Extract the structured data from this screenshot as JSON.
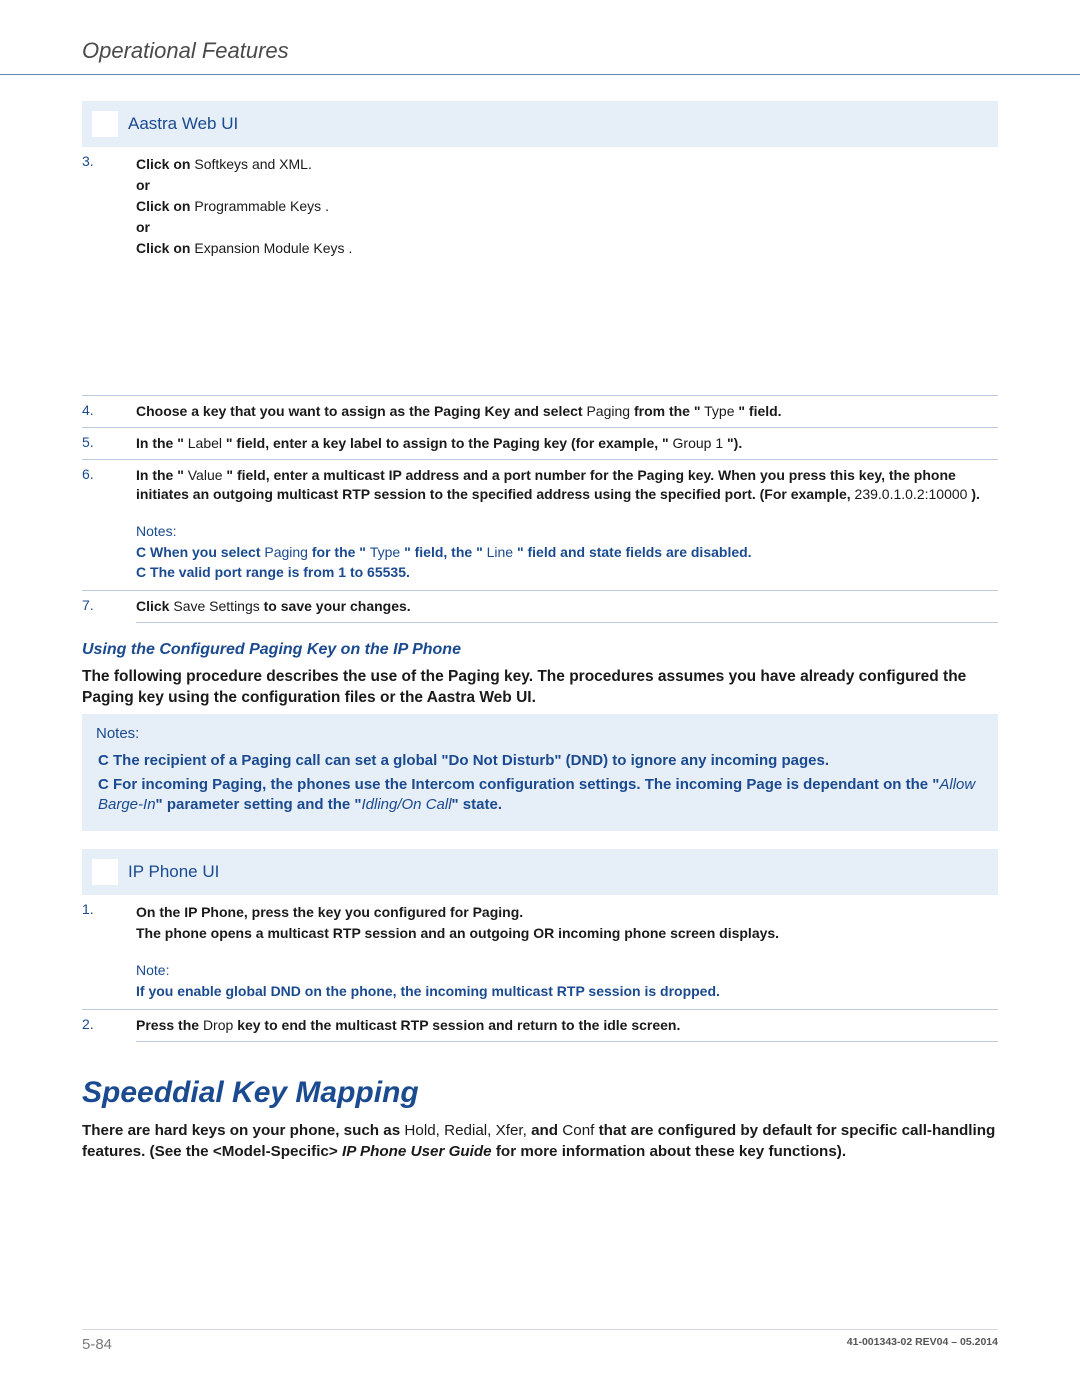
{
  "header_title": "Operational Features",
  "webui_bar_title": "Aastra Web UI",
  "step3_num": "3.",
  "step3_l1_a": "Click on",
  "step3_l1_b": " Softkeys and XML.",
  "step3_or": "or",
  "step3_l2_a": "Click on",
  "step3_l2_b": " Programmable Keys .",
  "step3_l3_a": "Click on",
  "step3_l3_b": " Expansion Module Keys .",
  "step4_num": "4.",
  "step4_a": "Choose a key that you want to assign as the Paging Key and select ",
  "step4_b": "Paging",
  "step4_c": " from the \"",
  "step4_d": "Type",
  "step4_e": "\" field.",
  "step5_num": "5.",
  "step5_a": "In the \"",
  "step5_b": "Label",
  "step5_c": "\" field, enter a key label to assign to the Paging key (for example, \"",
  "step5_d": "Group 1",
  "step5_e": "\").",
  "step6_num": "6.",
  "step6_a": "In the \"",
  "step6_b": "Value",
  "step6_c": "\" field, enter a multicast IP address and a port number for the Paging key. When you press this key, the phone initiates an outgoing multicast RTP session to the specified address using the specified port. (For example, ",
  "step6_d": "239.0.1.0.2:10000",
  "step6_e": ").",
  "step6_notes_label": "Notes:",
  "step6_note1_a": "C",
  "step6_note1_b": "When you select ",
  "step6_note1_c": "Paging",
  "step6_note1_d": " for the \"",
  "step6_note1_e": "Type",
  "step6_note1_f": "\" field, the \"",
  "step6_note1_g": "Line",
  "step6_note1_h": "\" field and state fields are disabled.",
  "step6_note2_a": "C",
  "step6_note2_b": "The valid port range is from 1 to 65535.",
  "step7_num": "7.",
  "step7_a": "Click ",
  "step7_b": "Save Settings",
  "step7_c": " to save your changes.",
  "sub_title": "Using the Configured Paging Key on the IP Phone",
  "intro_para": "The following procedure describes the use of the Paging key. The procedures assumes you have already configured the Paging key using the configuration files or the Aastra Web UI.",
  "notes_label2": "Notes:",
  "notes_b1_a": "C",
  "notes_b1_b": " The recipient of a Paging call can set a global \"Do Not Disturb\" (DND) to ignore any incoming pages.",
  "notes_b2_a": "C",
  "notes_b2_b": " For incoming Paging, the phones use the Intercom configuration settings. The incoming Page is dependant on the \"",
  "notes_b2_c": "Allow Barge-In",
  "notes_b2_d": "\" parameter setting and the \"",
  "notes_b2_e": "Idling/On Call",
  "notes_b2_f": "\" state.",
  "ipphone_bar_title": "IP Phone UI",
  "pstep1_num": "1.",
  "pstep1_l1": "On the IP Phone, press the key you configured for Paging.",
  "pstep1_l2": "The phone opens a multicast RTP session and an outgoing OR incoming phone screen displays.",
  "pstep1_note_label": "Note:",
  "pstep1_note_text": "If you enable global DND on the phone, the incoming multicast RTP session is dropped.",
  "pstep2_num": "2.",
  "pstep2_a": "Press the ",
  "pstep2_b": "Drop",
  "pstep2_c": " key to end the multicast RTP session and return to the idle screen.",
  "speed_title": "Speeddial Key Mapping",
  "speed_para_a": "There are hard keys on your phone, such as ",
  "speed_para_b": "Hold, Redial, Xfer,",
  "speed_para_c": " and ",
  "speed_para_d": "Conf",
  "speed_para_e": " that are configured by default for specific call-handling features. (See the <Model-Specific> ",
  "speed_para_f": "IP Phone User Guide",
  "speed_para_g": " for more information about these key functions).",
  "footer_left": "5-84",
  "footer_right": "41-001343-02 REV04 – 05.2014"
}
